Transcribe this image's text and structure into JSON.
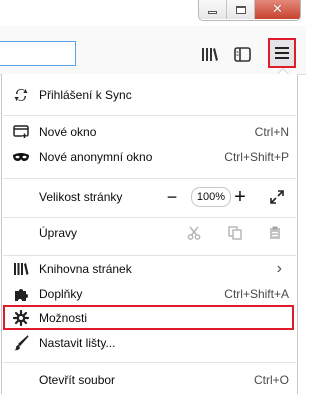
{
  "window": {
    "close_symbol": "✕"
  },
  "toolbar": {
    "library_icon": "library-icon",
    "sidebar_icon": "sidebar-icon",
    "menu_icon": "hamburger-icon"
  },
  "menu": {
    "sync": {
      "label": "Přihlášení k Sync"
    },
    "new_window": {
      "label": "Nové okno",
      "shortcut": "Ctrl+N"
    },
    "new_private": {
      "label": "Nové anonymní okno",
      "shortcut": "Ctrl+Shift+P"
    },
    "zoom": {
      "label": "Velikost stránky",
      "minus": "−",
      "value": "100%",
      "plus": "+"
    },
    "edit": {
      "label": "Úpravy"
    },
    "library": {
      "label": "Knihovna stránek",
      "chevron": "›"
    },
    "addons": {
      "label": "Doplňky",
      "shortcut": "Ctrl+Shift+A"
    },
    "options": {
      "label": "Možnosti"
    },
    "customize": {
      "label": "Nastavit lišty..."
    },
    "open_file": {
      "label": "Otevřít soubor",
      "shortcut": "Ctrl+O"
    }
  },
  "colors": {
    "highlight": "#e01b2b",
    "menu_button_bg": "#e5e5e7"
  }
}
